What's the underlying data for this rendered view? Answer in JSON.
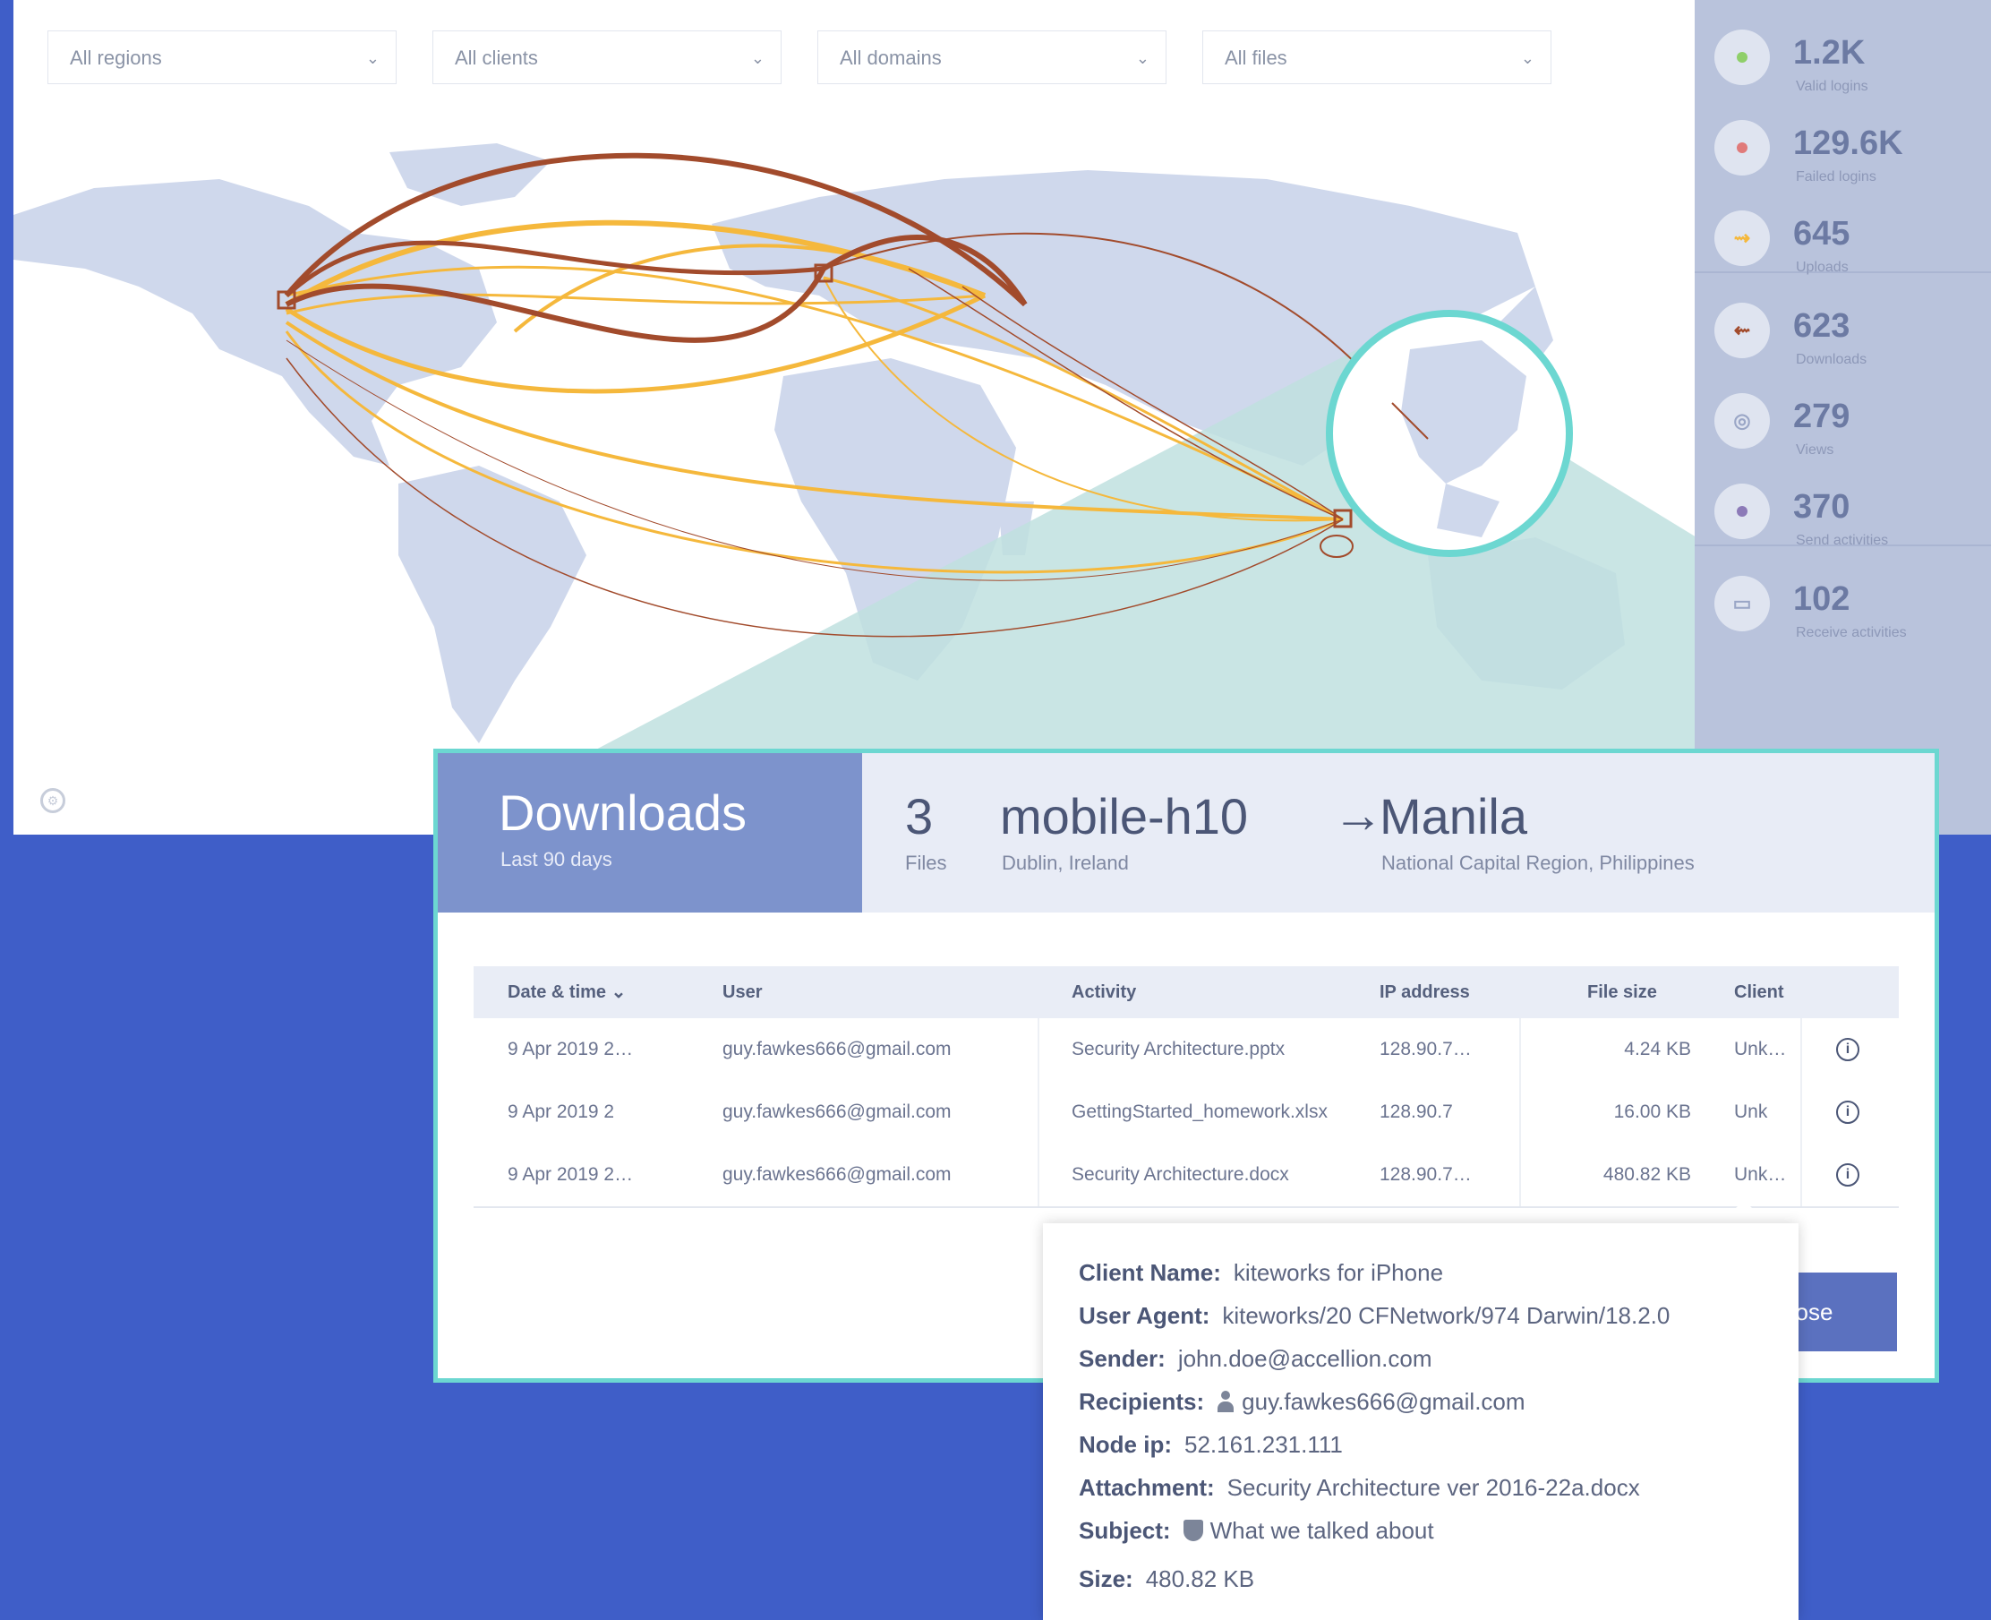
{
  "filters": [
    {
      "label": "All regions"
    },
    {
      "label": "All clients"
    },
    {
      "label": "All domains"
    },
    {
      "label": "All files"
    }
  ],
  "stats": [
    {
      "value": "1.2K",
      "label": "Valid logins",
      "color": "#8fcf6a",
      "glyph": ""
    },
    {
      "value": "129.6K",
      "label": "Failed logins",
      "color": "#e07a7a",
      "glyph": ""
    },
    {
      "value": "645",
      "label": "Uploads",
      "color": "#f5b83c",
      "glyph": "⇝"
    },
    {
      "value": "623",
      "label": "Downloads",
      "color": "#a24b2c",
      "glyph": "⇜"
    },
    {
      "value": "279",
      "label": "Views",
      "color": "#9aa6c6",
      "glyph": "◎"
    },
    {
      "value": "370",
      "label": "Send activities",
      "color": "#8c7ab8",
      "glyph": ""
    },
    {
      "value": "102",
      "label": "Receive activities",
      "color": "#9aa6c6",
      "glyph": "▭"
    }
  ],
  "popup": {
    "title": "Downloads",
    "subtitle": "Last 90 days",
    "count": "3",
    "count_label": "Files",
    "source": "mobile-h10",
    "source_location": "Dublin, Ireland",
    "arrow": "→",
    "destination": "Manila",
    "destination_location": "National Capital Region, Philippines",
    "close_label": "Close"
  },
  "table": {
    "headers": [
      "Date & time ⌄",
      "User",
      "Activity",
      "IP address",
      "File size",
      "Client"
    ],
    "rows": [
      {
        "date": "9 Apr 2019 2…",
        "user": "guy.fawkes666@gmail.com",
        "activity": "Security Architecture.pptx",
        "ip": "128.90.7…",
        "size": "4.24 KB",
        "client": "Unk…"
      },
      {
        "date": "9 Apr 2019 2",
        "user": "guy.fawkes666@gmail.com",
        "activity": "GettingStarted_homework.xlsx",
        "ip": "128.90.7",
        "size": "16.00 KB",
        "client": "Unk"
      },
      {
        "date": "9 Apr 2019 2…",
        "user": "guy.fawkes666@gmail.com",
        "activity": "Security Architecture.docx",
        "ip": "128.90.7…",
        "size": "480.82 KB",
        "client": "Unk…"
      }
    ]
  },
  "tooltip": {
    "client_name_key": "Client Name:",
    "client_name": "kiteworks for iPhone",
    "user_agent_key": "User Agent:",
    "user_agent": "kiteworks/20 CFNetwork/974 Darwin/18.2.0",
    "sender_key": "Sender:",
    "sender": "john.doe@accellion.com",
    "recipients_key": "Recipients:",
    "recipients": "guy.fawkes666@gmail.com",
    "node_ip_key": "Node ip:",
    "node_ip": "52.161.231.111",
    "attachment_key": "Attachment:",
    "attachment": "Security Architecture ver 2016-22a.docx",
    "subject_key": "Subject:",
    "subject": "What we talked about",
    "size_key": "Size:",
    "size": "480.82 KB"
  },
  "colors": {
    "background": "#3f5ec8",
    "upload_arc": "#f5b83c",
    "download_arc": "#a24b2c",
    "land": "#cfd8ec",
    "popup_border": "#6cd7d1",
    "highlight_wedge": "#bfe1df"
  }
}
